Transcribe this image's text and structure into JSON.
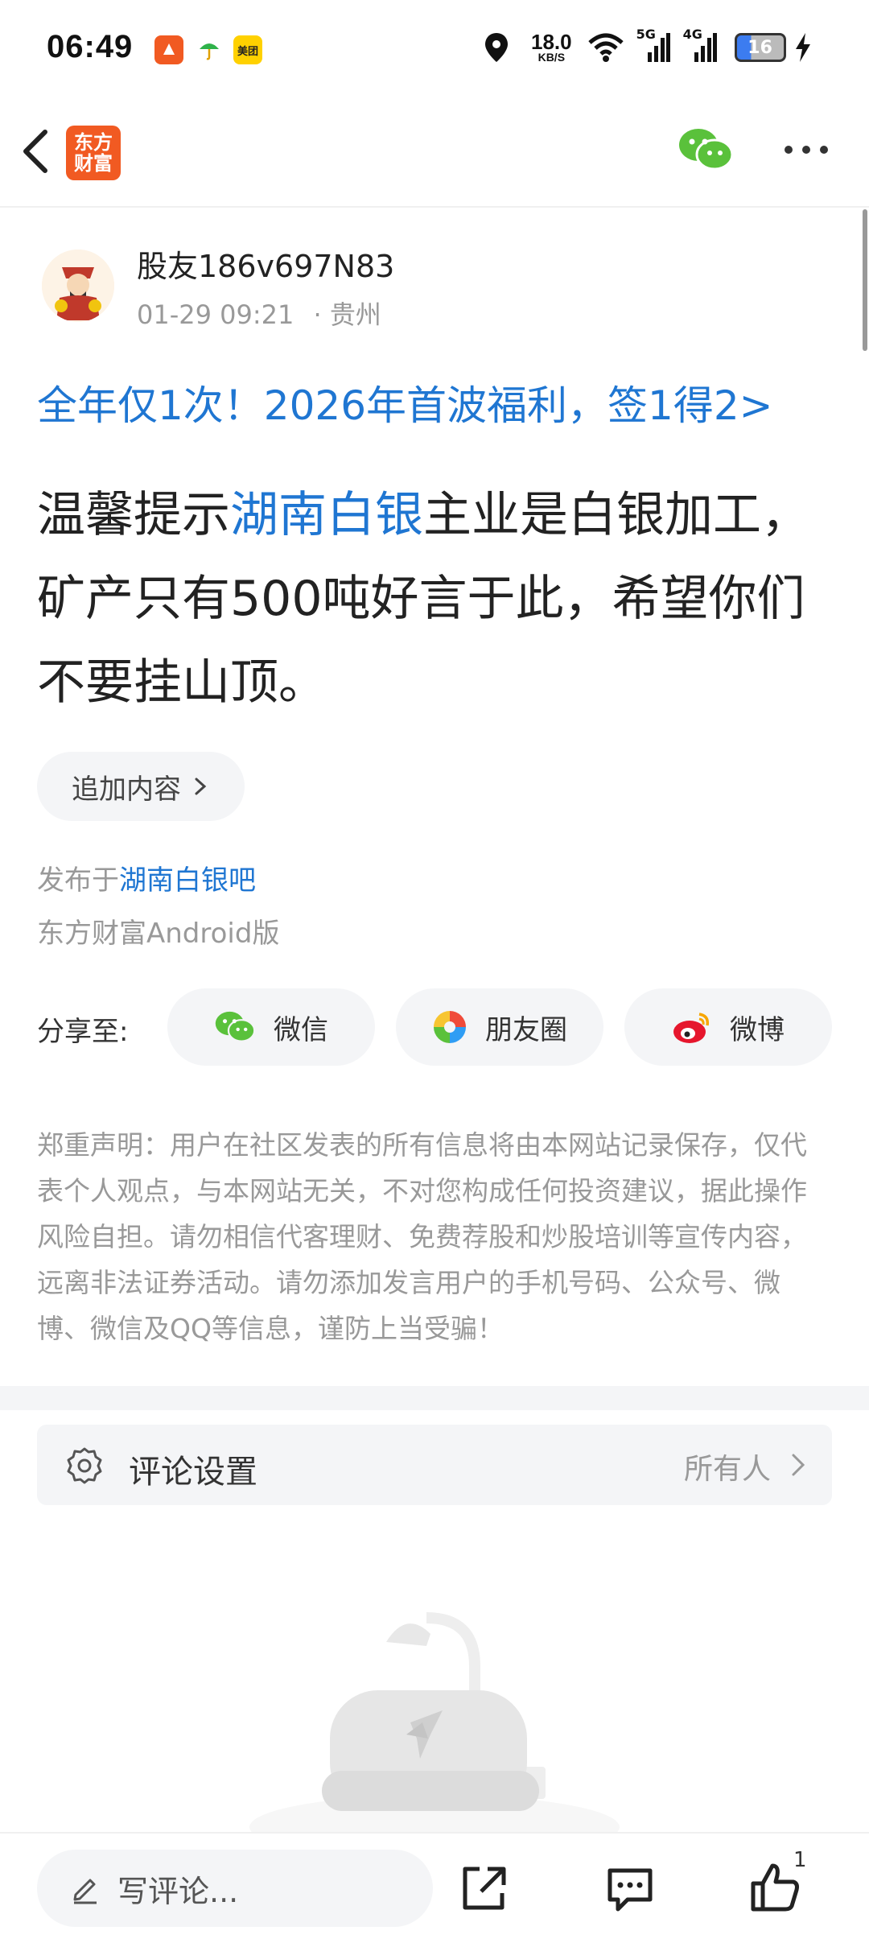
{
  "status_bar": {
    "time": "06:49",
    "app_badges": [
      {
        "name": "app-badge-orange",
        "color": "#f15a22",
        "text": ""
      },
      {
        "name": "app-badge-umbrella",
        "color": "#ffffff",
        "text": ""
      },
      {
        "name": "app-badge-meituan",
        "color": "#ffd100",
        "text": "美团"
      }
    ],
    "net_speed_value": "18.0",
    "net_speed_unit": "KB/S",
    "signal_5g": "5G",
    "signal_4g": "4G",
    "battery": "16"
  },
  "nav": {
    "logo_line1": "东方",
    "logo_line2": "财富"
  },
  "post": {
    "author": "股友186v697N83",
    "date": "01-29 09:21",
    "location": "· 贵州",
    "promo": "全年仅1次！2026年首波福利，签1得2>",
    "body_prefix": "温馨提示",
    "body_highlight": "湖南白银",
    "body_rest": "主业是白银加工，矿产只有500吨好言于此，希望你们不要挂山顶。",
    "add_content_label": "追加内容",
    "published_prefix": "发布于",
    "published_forum": "湖南白银吧",
    "source": "东方财富Android版"
  },
  "share": {
    "label": "分享至:",
    "buttons": [
      {
        "label": "微信"
      },
      {
        "label": "朋友圈"
      },
      {
        "label": "微博"
      }
    ]
  },
  "disclaimer": "郑重声明：用户在社区发表的所有信息将由本网站记录保存，仅代表个人观点，与本网站无关，不对您构成任何投资建议，据此操作风险自担。请勿相信代客理财、免费荐股和炒股培训等宣传内容，远离非法证券活动。请勿添加发言用户的手机号码、公众号、微博、微信及QQ等信息，谨防上当受骗！",
  "comment_settings": {
    "label": "评论设置",
    "value": "所有人"
  },
  "bottom_bar": {
    "comment_placeholder": "写评论...",
    "like_count": "1"
  },
  "colors": {
    "link_blue": "#1f76d2",
    "brand_orange": "#f15a22",
    "wechat_green": "#5ac13b"
  }
}
